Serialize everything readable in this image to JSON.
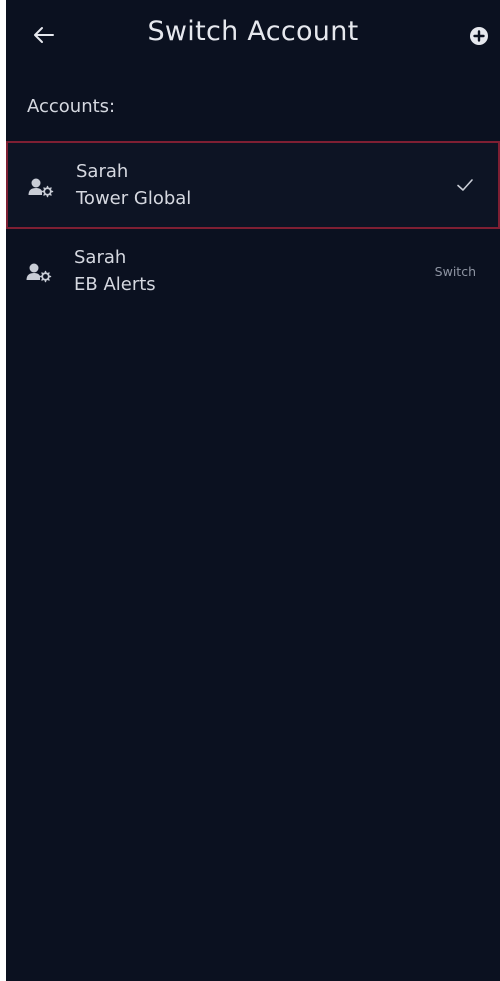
{
  "header": {
    "title": "Switch Account",
    "back_icon": "arrow-left-icon",
    "add_icon": "plus-circle-icon"
  },
  "section": {
    "label": "Accounts:"
  },
  "accounts": [
    {
      "name": "Sarah",
      "organization": "Tower Global",
      "active": true,
      "icon": "user-settings-icon",
      "action_icon": "check-icon"
    },
    {
      "name": "Sarah",
      "organization": "EB Alerts",
      "active": false,
      "icon": "user-settings-icon",
      "action_label": "Switch"
    }
  ],
  "colors": {
    "background": "#0b1120",
    "active_border": "#7e1f33",
    "text": "#d5d8e0"
  }
}
